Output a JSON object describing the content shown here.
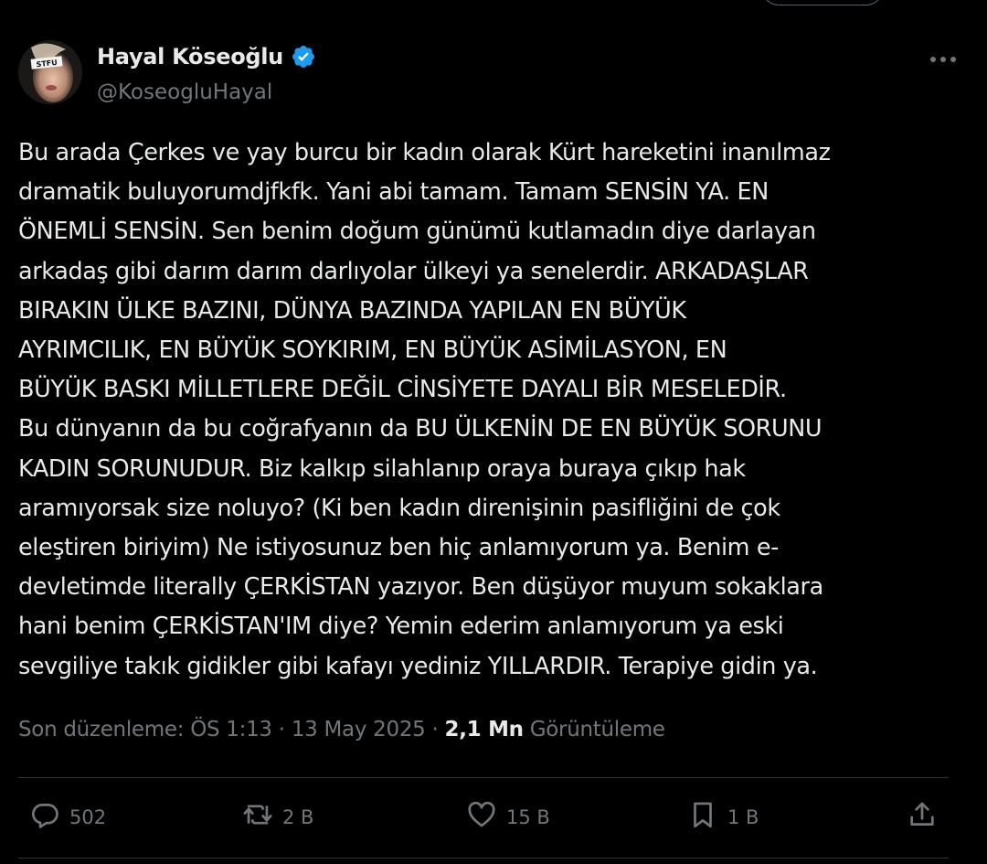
{
  "author": {
    "display_name": "Hayal Köseoğlu",
    "handle": "@KoseogluHayal",
    "verified": true,
    "avatar_badge_text": "STFU"
  },
  "tweet": {
    "text": "Bu arada Çerkes ve yay burcu bir kadın olarak Kürt hareketini inanılmaz\ndramatik buluyorumdjfkfk. Yani abi tamam. Tamam SENSİN YA. EN\nÖNEMLİ SENSİN. Sen benim doğum günümü kutlamadın diye darlayan\narkadaş gibi darım darım darlıyolar ülkeyi ya senelerdir. ARKADAŞLAR\nBIRAKIN ÜLKE BAZINI,  DÜNYA BAZINDA YAPILAN EN BÜYÜK\nAYRIMCILIK, EN BÜYÜK SOYKIRIM, EN BÜYÜK ASİMİLASYON, EN\nBÜYÜK BASKI MİLLETLERE DEĞİL CİNSİYETE DAYALI BİR MESELEDİR.\nBu dünyanın da  bu coğrafyanın da BU ÜLKENİN DE EN BÜYÜK SORUNU\nKADIN SORUNUDUR. Biz kalkıp silahlanıp oraya buraya çıkıp hak\naramıyorsak size noluyo? (Ki ben kadın direnişinin pasifliğini de çok\neleştiren biriyim) Ne istiyosunuz ben hiç anlamıyorum ya. Benim e-\ndevletimde literally ÇERKİSTAN yazıyor. Ben düşüyor muyum sokaklara\nhani benim ÇERKİSTAN'IM diye? Yemin ederim anlamıyorum ya eski\nsevgiliye takık gidikler gibi kafayı yediniz YILLARDIR. Terapiye gidin ya."
  },
  "meta": {
    "edited_label": "Son düzenleme: ÖS 1:13",
    "separator": "·",
    "date": "13 May 2025",
    "views_count": "2,1 Mn",
    "views_label": "Görüntüleme"
  },
  "actions": {
    "replies": "502",
    "reposts": "2 B",
    "likes": "15 B",
    "bookmarks": "1 B"
  },
  "colors": {
    "background": "#000000",
    "text": "#e7e9ea",
    "secondary": "#71767b",
    "verified": "#1d9bf0",
    "divider": "#2f3336"
  },
  "icons": [
    "more-icon",
    "verified-badge-icon",
    "reply-icon",
    "repost-icon",
    "like-icon",
    "bookmark-icon",
    "share-icon"
  ]
}
